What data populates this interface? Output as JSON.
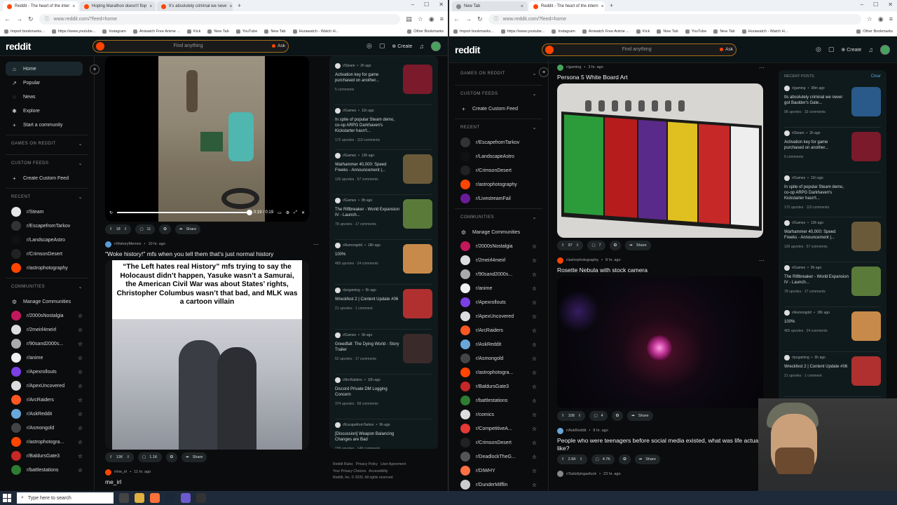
{
  "left_browser": {
    "tabs": [
      {
        "title": "Reddit - The heart of the inter"
      },
      {
        "title": "Hoping Marathon doesn't flop"
      },
      {
        "title": "It's absolutely criminal we neve"
      }
    ],
    "url": "www.reddit.com/?feed=home",
    "bookmarks": [
      "Import bookmarks...",
      "https://www.youtube...",
      "Instagram",
      "Aniwatch Free Anime ...",
      "Kick",
      "New Tab",
      "YouTube",
      "New Tab",
      "Hurawatch - Watch H..."
    ],
    "other_bookmarks": "Other Bookmarks"
  },
  "right_browser": {
    "tabs": [
      {
        "title": "New Tab"
      },
      {
        "title": "Reddit - The heart of the intern"
      }
    ],
    "url": "www.reddit.com/?feed=home",
    "bookmarks": [
      "Import bookmarks...",
      "https://www.youtube...",
      "Instagram",
      "Aniwatch Free Anime ...",
      "Kick",
      "New Tab",
      "YouTube",
      "New Tab",
      "Hurawatch - Watch H..."
    ],
    "other_bookmarks": "Other Bookmarks"
  },
  "reddit": {
    "logo": "reddit",
    "search_placeholder": "Find anything",
    "ask_label": "Ask",
    "create_label": "Create"
  },
  "left_nav": {
    "main": [
      {
        "label": "Home",
        "icon": "home-icon"
      },
      {
        "label": "Popular",
        "icon": "popular-icon"
      },
      {
        "label": "News",
        "icon": "news-icon"
      },
      {
        "label": "Explore",
        "icon": "explore-icon"
      },
      {
        "label": "Start a community",
        "icon": "plus-icon"
      }
    ],
    "games_header": "GAMES ON REDDIT",
    "custom_feeds_header": "CUSTOM FEEDS",
    "create_custom_feed": "Create Custom Feed",
    "recent_header": "RECENT",
    "recent": [
      {
        "label": "r/Steam",
        "color": "#e6e6e6"
      },
      {
        "label": "r/EscapefromTarkov",
        "color": "#333333"
      },
      {
        "label": "r/LandscapeAstro",
        "color": "#111111"
      },
      {
        "label": "r/CrimsonDesert",
        "color": "#222222"
      },
      {
        "label": "r/astrophotography",
        "color": "#ff4500"
      }
    ],
    "communities_header": "COMMUNITIES",
    "manage_communities": "Manage Communities",
    "communities": [
      {
        "label": "r/2000sNostalgia",
        "color": "#c2185b"
      },
      {
        "label": "r/2meirl4meirl",
        "color": "#dddddd"
      },
      {
        "label": "r/90sand2000s...",
        "color": "#aaaaaa"
      },
      {
        "label": "r/anime",
        "color": "#f0f0f0"
      },
      {
        "label": "r/Apexrollouts",
        "color": "#7b3fe4"
      },
      {
        "label": "r/ApexUncovered",
        "color": "#dddddd"
      },
      {
        "label": "r/ArcRaiders",
        "color": "#ff5722"
      },
      {
        "label": "r/AskReddit",
        "color": "#69a7d8"
      },
      {
        "label": "r/Asmongold",
        "color": "#444444"
      },
      {
        "label": "r/astrophotogra...",
        "color": "#ff4500"
      },
      {
        "label": "r/BaldursGate3",
        "color": "#c62828"
      },
      {
        "label": "r/battlestations",
        "color": "#2e7d32"
      }
    ]
  },
  "right_nav": {
    "games_header": "GAMES ON REDDIT",
    "custom_feeds_header": "CUSTOM FEEDS",
    "create_custom_feed": "Create Custom Feed",
    "recent_header": "RECENT",
    "recent": [
      {
        "label": "r/EscapefromTarkov",
        "color": "#333333"
      },
      {
        "label": "r/LandscapeAstro",
        "color": "#111111"
      },
      {
        "label": "r/CrimsonDesert",
        "color": "#222222"
      },
      {
        "label": "r/astrophotography",
        "color": "#ff4500"
      },
      {
        "label": "r/LivestreamFail",
        "color": "#6a1b9a"
      }
    ],
    "communities_header": "COMMUNITIES",
    "manage_communities": "Manage Communities",
    "communities": [
      {
        "label": "r/2000sNostalgia",
        "color": "#c2185b"
      },
      {
        "label": "r/2meirl4meirl",
        "color": "#dddddd"
      },
      {
        "label": "r/90sand2000s...",
        "color": "#aaaaaa"
      },
      {
        "label": "r/anime",
        "color": "#f0f0f0"
      },
      {
        "label": "r/Apexrollouts",
        "color": "#7b3fe4"
      },
      {
        "label": "r/ApexUncovered",
        "color": "#dddddd"
      },
      {
        "label": "r/ArcRaiders",
        "color": "#ff5722"
      },
      {
        "label": "r/AskReddit",
        "color": "#69a7d8"
      },
      {
        "label": "r/Asmongold",
        "color": "#444444"
      },
      {
        "label": "r/astrophotogra...",
        "color": "#ff4500"
      },
      {
        "label": "r/BaldursGate3",
        "color": "#c62828"
      },
      {
        "label": "r/battlestations",
        "color": "#2e7d32"
      },
      {
        "label": "r/comics",
        "color": "#dddddd"
      },
      {
        "label": "r/CompetitiveA...",
        "color": "#e53935"
      },
      {
        "label": "r/CrimsonDesert",
        "color": "#222222"
      },
      {
        "label": "r/DeadlockTheG...",
        "color": "#555555"
      },
      {
        "label": "r/DIWHY",
        "color": "#ff7043"
      },
      {
        "label": "r/DunderMifflin",
        "color": "#cccccc"
      }
    ]
  },
  "left_feed": {
    "video_post": {
      "time": "0:19 / 0:19",
      "progress": 1.0,
      "upvotes": "18",
      "comments": "11",
      "share": "Share"
    },
    "meme_post": {
      "subreddit": "r/HistoryMemes",
      "age": "10 hr. ago",
      "title": "\"Woke history!\" mfs when you tell them that's just normal history",
      "meme_text": "“The Left hates real History” mfs trying to say the Holocaust didn’t happen, Yasuke wasn’t a Samurai, the American Civil War was about States’ rights, Christopher Columbus wasn’t that bad, and MLK was a cartoon villain",
      "upvotes": "13K",
      "comments": "1.1K",
      "share": "Share"
    },
    "next_post": {
      "subreddit": "r/me_irl",
      "age": "11 hr. ago",
      "title": "me_irl"
    }
  },
  "left_rail": {
    "items": [
      {
        "sub": "r/Steam",
        "age": "2h ago",
        "title": "Activation key for game purchased on another...",
        "stats": "5 comments",
        "thumb_color": "#7a1a2a"
      },
      {
        "sub": "r/Games",
        "age": "11h ago",
        "title": "In spite of popular Steam demo, co-op ARPG Darkhaven's Kickstarter hasn't...",
        "stats": "172 upvotes · 110 comments",
        "thumb_color": ""
      },
      {
        "sub": "r/Games",
        "age": "13h ago",
        "title": "Warhammer 40,000: Speed Freeks - Announcement |...",
        "stats": "126 upvotes · 57 comments",
        "thumb_color": "#6b5a3a"
      },
      {
        "sub": "r/Games",
        "age": "8h ago",
        "title": "The Riftbreaker - World Expansion IV - Launch...",
        "stats": "78 upvotes · 17 comments",
        "thumb_color": "#5a7a3a"
      },
      {
        "sub": "r/Asmongold",
        "age": "18h ago",
        "title": "100%",
        "stats": "465 upvotes · 24 comments",
        "thumb_color": "#c88a4a"
      },
      {
        "sub": "r/pcgaming",
        "age": "6h ago",
        "title": "Wreckfest 2 | Content Update #06",
        "stats": "21 upvotes · 1 comment",
        "thumb_color": "#b03030"
      },
      {
        "sub": "r/Games",
        "age": "9h ago",
        "title": "Greedfall: The Dying World - Story Trailer",
        "stats": "52 upvotes · 17 comments",
        "thumb_color": "#3a2a2a"
      },
      {
        "sub": "r/ArcRaiders",
        "age": "10h ago",
        "title": "Discord Private DM Logging Concern",
        "stats": "374 upvotes · 58 comments",
        "thumb_color": ""
      },
      {
        "sub": "r/EscapefromTarkov",
        "age": "9h ago",
        "title": "[Discussion] Weapon Balancing Changes are Bad",
        "stats": "159 upvotes · 149 comments",
        "thumb_color": ""
      }
    ],
    "footer": [
      "Reddit Rules",
      "Privacy Policy",
      "User Agreement",
      "Your Privacy Choices",
      "Accessibility",
      "Reddit, Inc. © 2026. All rights reserved."
    ]
  },
  "right_feed": {
    "persona_post": {
      "subreddit": "r/gaming",
      "age": "3 hr. ago",
      "title": "Persona 5 White Board Art",
      "upvotes": "97",
      "comments": "7",
      "share": "Share"
    },
    "nebula_post": {
      "subreddit": "r/astrophotography",
      "age": "8 hr. ago",
      "title": "Rosette Nebula with stock camera",
      "upvotes": "108",
      "comments": "4",
      "share": "Share"
    },
    "ask_post": {
      "subreddit": "r/AskReddit",
      "age": "8 hr. ago",
      "title": "People who were teenagers before social media existed, what was life actually like?",
      "upvotes": "2.6K",
      "comments": "4.7K",
      "share": "Share"
    },
    "last_post": {
      "subreddit": "r/Satisfyingasfuck",
      "age": "23 hr. ago"
    }
  },
  "right_rail": {
    "title": "RECENT POSTS",
    "clear": "Clear",
    "items": [
      {
        "sub": "r/gaming",
        "age": "38m ago",
        "title": "Its absolutely criminal we never got Baulder's Gate...",
        "stats": "98 upvotes · 33 comments",
        "thumb_color": "#2a5a8a"
      },
      {
        "sub": "r/Steam",
        "age": "2h ago",
        "title": "Activation key for game purchased on another...",
        "stats": "5 comments",
        "thumb_color": "#7a1a2a"
      },
      {
        "sub": "r/Games",
        "age": "11h ago",
        "title": "In spite of popular Steam demo, co-op ARPG Darkhaven's Kickstarter hasn't...",
        "stats": "172 upvotes · 110 comments",
        "thumb_color": ""
      },
      {
        "sub": "r/Games",
        "age": "13h ago",
        "title": "Warhammer 40,000: Speed Freeks - Announcement |...",
        "stats": "126 upvotes · 57 comments",
        "thumb_color": "#6b5a3a"
      },
      {
        "sub": "r/Games",
        "age": "8h ago",
        "title": "The Riftbreaker - World Expansion IV - Launch...",
        "stats": "78 upvotes · 17 comments",
        "thumb_color": "#5a7a3a"
      },
      {
        "sub": "r/Asmongold",
        "age": "18h ago",
        "title": "100%",
        "stats": "465 upvotes · 24 comments",
        "thumb_color": "#c88a4a"
      },
      {
        "sub": "r/pcgaming",
        "age": "6h ago",
        "title": "Wreckfest 2 | Content Update #06",
        "stats": "21 upvotes · 1 comment",
        "thumb_color": "#b03030"
      }
    ]
  },
  "taskbar": {
    "search_placeholder": "Type here to search"
  }
}
